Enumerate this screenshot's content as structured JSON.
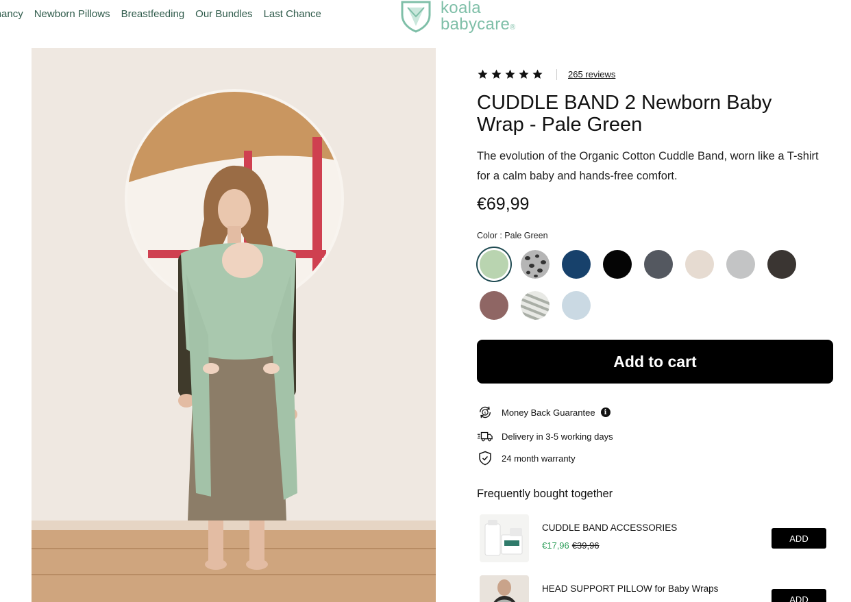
{
  "header": {
    "nav": [
      "Pregnancy",
      "Newborn Pillows",
      "Breastfeeding",
      "Our Bundles",
      "Last Chance"
    ],
    "logo_line1": "koala",
    "logo_line2": "babycare",
    "logo_mark": "®"
  },
  "product": {
    "reviews": "265 reviews",
    "title": "CUDDLE BAND 2 Newborn Baby Wrap - Pale Green",
    "description": "The evolution of the Organic Cotton Cuddle Band, worn like a T-shirt for a calm baby and hands-free comfort.",
    "price": "€69,99",
    "color_label": "Color : Pale Green",
    "swatches": [
      {
        "name": "Pale Green",
        "color": "#b9d4b0",
        "selected": true
      },
      {
        "name": "Leopard",
        "color": "#8b8b8b",
        "pattern": "leopard"
      },
      {
        "name": "Navy",
        "color": "#17416b"
      },
      {
        "name": "Black",
        "color": "#050505"
      },
      {
        "name": "Dark Grey",
        "color": "#545860"
      },
      {
        "name": "Beige",
        "color": "#e6dbd1"
      },
      {
        "name": "Light Grey",
        "color": "#c3c4c5"
      },
      {
        "name": "Charcoal",
        "color": "#3a3532"
      },
      {
        "name": "Mauve",
        "color": "#8f6664"
      },
      {
        "name": "Stripes",
        "color": "#c8cbc4",
        "pattern": "stripes"
      },
      {
        "name": "Light Blue",
        "color": "#cad9e3"
      }
    ],
    "add_to_cart": "Add to cart",
    "features": [
      {
        "icon": "money-back-icon",
        "label": "Money Back Guarantee",
        "info": "i"
      },
      {
        "icon": "delivery-truck-icon",
        "label": "Delivery in 3-5 working days"
      },
      {
        "icon": "shield-check-icon",
        "label": "24 month warranty"
      }
    ]
  },
  "fbt": {
    "title": "Frequently bought together",
    "items": [
      {
        "name": "CUDDLE BAND ACCESSORIES",
        "sale_price": "€17,96",
        "original_price": "€39,96",
        "button": "ADD"
      },
      {
        "name": "HEAD SUPPORT PILLOW for Baby Wraps",
        "button": "ADD"
      }
    ]
  },
  "colors": {
    "brand_green": "#7fbfa8",
    "nav_text": "#2e5a4a",
    "sale_green": "#2e9e5a",
    "button_black": "#000000"
  }
}
